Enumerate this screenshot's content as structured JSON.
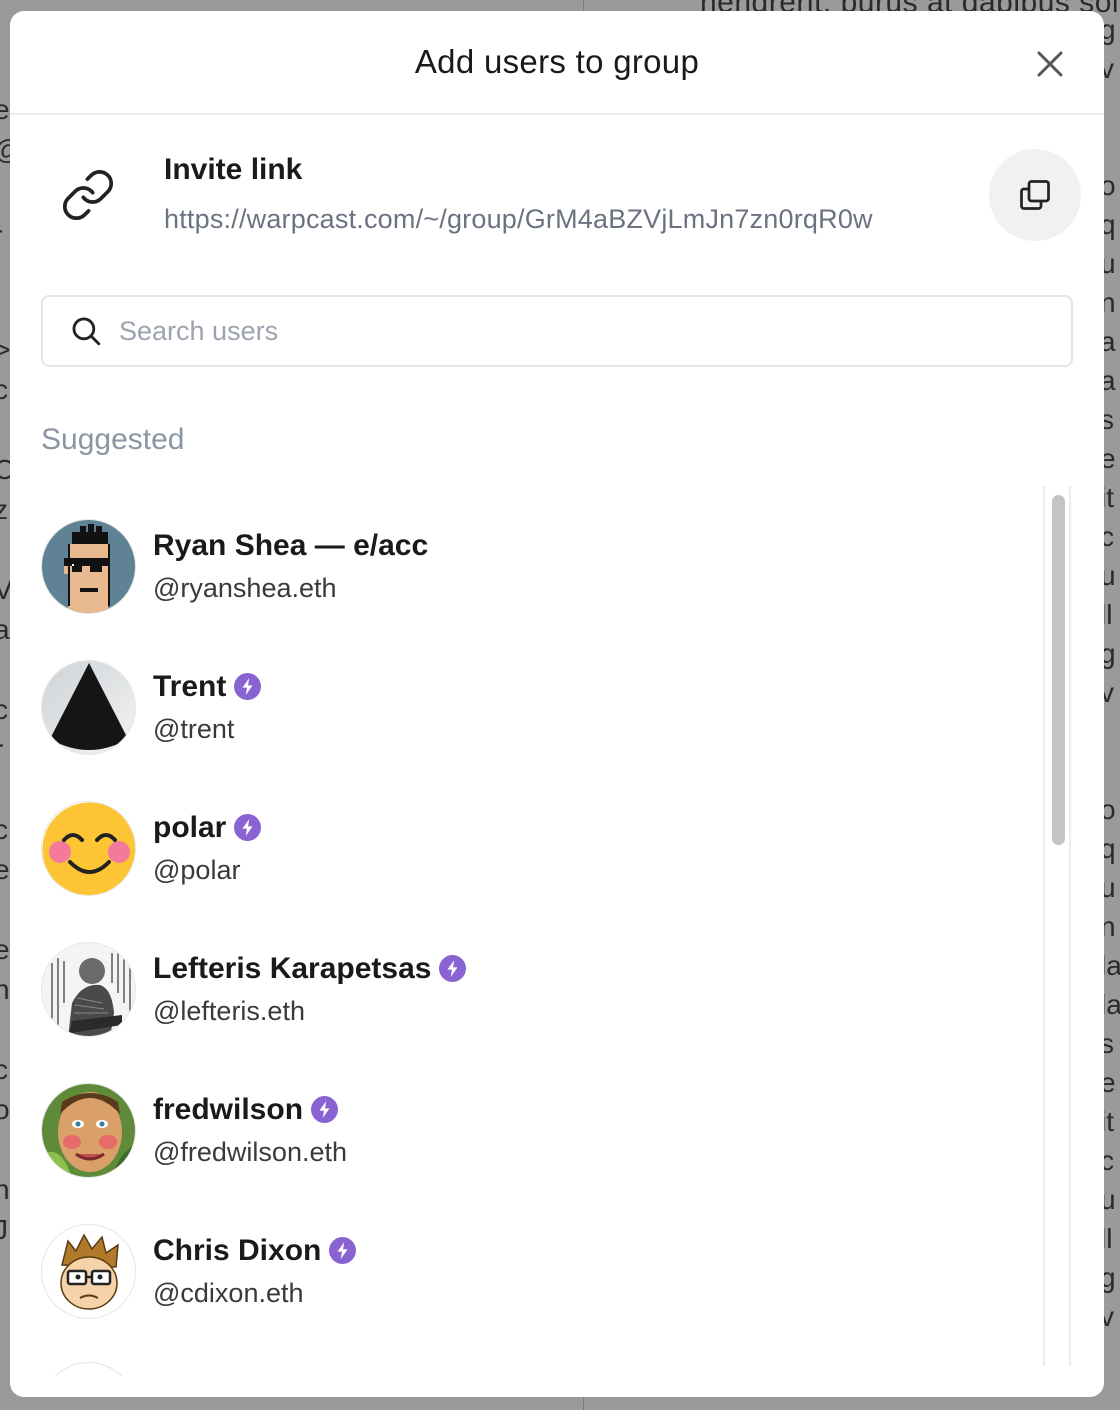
{
  "background": {
    "top_text": "hendrerit, purus at dapibus sol",
    "right_letters": [
      "g",
      "v",
      "",
      "",
      "o",
      "q",
      "u",
      "n",
      "a",
      "a",
      "s",
      "e",
      "it",
      "c",
      "u",
      "ll",
      "g",
      "v",
      "",
      "",
      "o",
      "q",
      "u",
      "n",
      "la",
      "la",
      "s",
      "e",
      "it",
      "c",
      "u",
      "ll",
      "g",
      "v"
    ],
    "left_letters": [
      "",
      "e",
      "@",
      "",
      "-",
      "l",
      "",
      "&gt;",
      "c",
      "",
      "C",
      "z",
      "",
      "V",
      "a",
      "",
      "c",
      "r",
      "",
      "c",
      "e",
      "",
      "e",
      "n",
      "",
      "c",
      "o",
      "",
      "n",
      "J"
    ]
  },
  "modal": {
    "title": "Add users to group",
    "close_icon": "close-icon",
    "invite": {
      "title": "Invite link",
      "url": "https://warpcast.com/~/group/GrM4aBZVjLmJn7zn0rqR0w",
      "link_icon": "link-icon",
      "copy_icon": "copy-icon"
    },
    "search": {
      "placeholder": "Search users",
      "value": ""
    },
    "suggested_label": "Suggested",
    "users": [
      {
        "name": "Ryan Shea — e/acc",
        "handle": "@ryanshea.eth",
        "verified": false,
        "avatar": "pixel-punk"
      },
      {
        "name": "Trent",
        "handle": "@trent",
        "verified": true,
        "avatar": "dark-pyramid"
      },
      {
        "name": "polar",
        "handle": "@polar",
        "verified": true,
        "avatar": "smiley-face"
      },
      {
        "name": "Lefteris Karapetsas",
        "handle": "@lefteris.eth",
        "verified": true,
        "avatar": "sketch-portrait"
      },
      {
        "name": "fredwilson",
        "handle": "@fredwilson.eth",
        "verified": true,
        "avatar": "painted-face"
      },
      {
        "name": "Chris Dixon",
        "handle": "@cdixon.eth",
        "verified": true,
        "avatar": "cartoon-glasses"
      }
    ]
  },
  "colors": {
    "badge": "#8a63d2",
    "muted": "#6b7280",
    "overlay": "#9a9a9a"
  }
}
